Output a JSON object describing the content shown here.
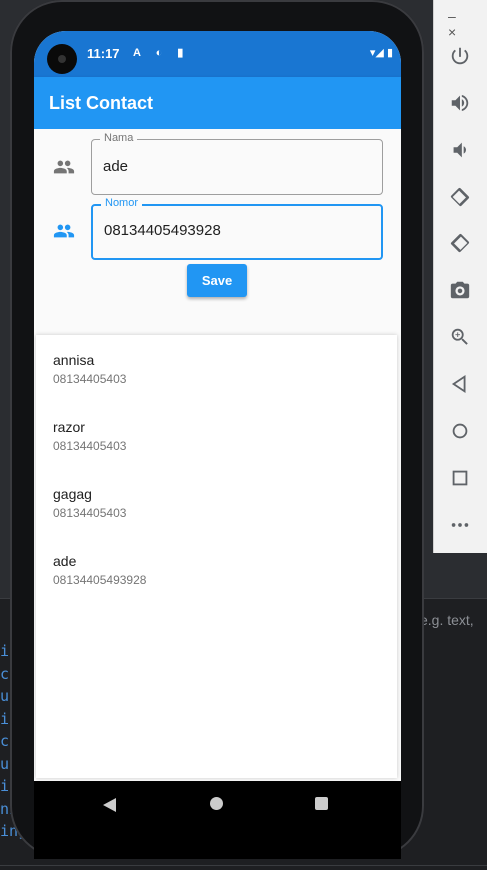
{
  "ide": {
    "search_placeholder": "e.g. text,",
    "code_lines": [
      "ir",
      "ca",
      "ut",
      "ir",
      "ca",
      "ut",
      "ir",
      "ni",
      "ing ou"
    ]
  },
  "emulator": {
    "minimize": "–",
    "close": "×",
    "buttons": [
      "power-icon",
      "volume-up-icon",
      "volume-down-icon",
      "rotate-left-icon",
      "rotate-right-icon",
      "camera-icon",
      "zoom-icon",
      "back-icon",
      "home-icon",
      "overview-icon",
      "more-icon"
    ]
  },
  "statusbar": {
    "time": "11:17",
    "icons": "A ◐ ▮",
    "system": "▾◢ ▮"
  },
  "app": {
    "title": "List Contact",
    "accent": "#2196f3"
  },
  "form": {
    "nama_label": "Nama",
    "nama_value": "ade",
    "nomor_label": "Nomor",
    "nomor_value": "08134405493928",
    "save_label": "Save"
  },
  "contacts": [
    {
      "name": "annisa",
      "number": "08134405403"
    },
    {
      "name": "razor",
      "number": "08134405403"
    },
    {
      "name": "gagag",
      "number": "08134405403"
    },
    {
      "name": "ade",
      "number": "08134405493928"
    }
  ]
}
